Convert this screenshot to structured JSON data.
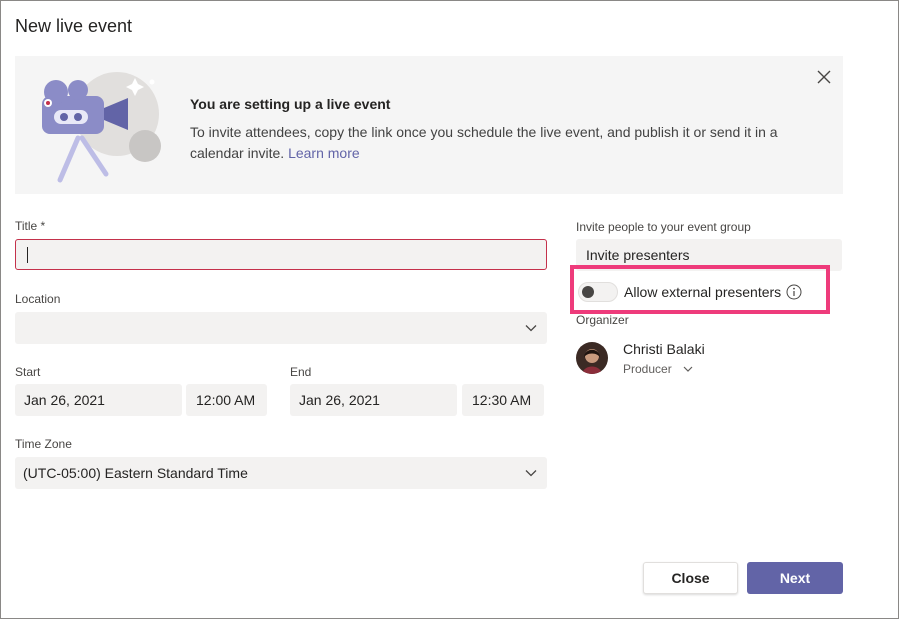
{
  "dialog": {
    "title": "New live event"
  },
  "banner": {
    "heading": "You are setting up a live event",
    "text": "To invite attendees, copy the link once you schedule the live event, and publish it or send it in a calendar invite.",
    "link": "Learn more",
    "close_icon": "close-icon",
    "illustration": "camera-illustration"
  },
  "form": {
    "title_label": "Title *",
    "title_value": "",
    "location_label": "Location",
    "location_value": "",
    "start_label": "Start",
    "start_date": "Jan 26, 2021",
    "start_time": "12:00 AM",
    "end_label": "End",
    "end_date": "Jan 26, 2021",
    "end_time": "12:30 AM",
    "timezone_label": "Time Zone",
    "timezone_value": "(UTC-05:00) Eastern Standard Time"
  },
  "invite": {
    "label": "Invite people to your event group",
    "placeholder": "Invite presenters",
    "toggle_label": "Allow external presenters",
    "toggle_on": false,
    "info_icon": "info-icon"
  },
  "organizer": {
    "label": "Organizer",
    "name": "Christi Balaki",
    "role": "Producer"
  },
  "actions": {
    "close": "Close",
    "next": "Next"
  },
  "colors": {
    "accent": "#6264a7",
    "error_border": "#c4314b",
    "highlight": "#ee3b7b"
  }
}
